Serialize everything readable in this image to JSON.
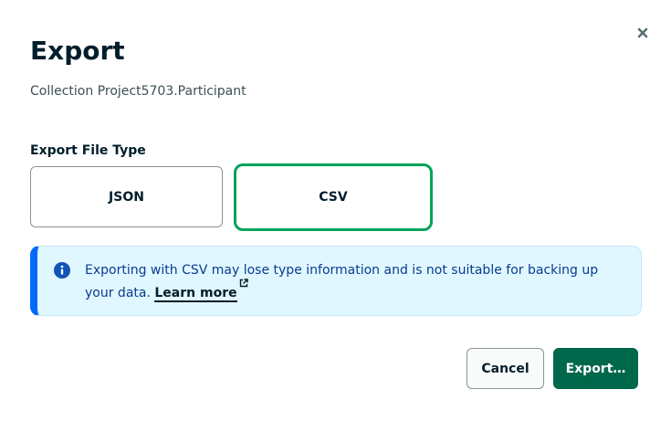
{
  "dialog": {
    "title": "Export",
    "subtitle": "Collection Project5703.Participant",
    "close_icon": "close-icon"
  },
  "file_type": {
    "label": "Export File Type",
    "options": [
      {
        "label": "JSON",
        "selected": false
      },
      {
        "label": "CSV",
        "selected": true
      }
    ]
  },
  "info_banner": {
    "icon": "info-icon",
    "message": "Exporting with CSV may lose type information and is not suitable for backing up your data.",
    "link_label": "Learn more",
    "link_icon": "external-link-icon"
  },
  "footer": {
    "cancel_label": "Cancel",
    "export_label": "Export…"
  },
  "colors": {
    "primary": "#00684a",
    "selected_border": "#00a35c",
    "banner_background": "#e1f7ff",
    "banner_accent": "#016bf8"
  }
}
